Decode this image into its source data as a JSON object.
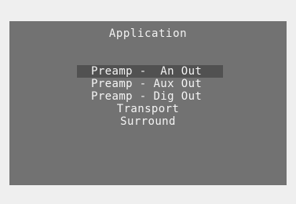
{
  "screen": {
    "title": "Application"
  },
  "menu": {
    "items": [
      {
        "label": "Preamp -  An Out",
        "selected": true
      },
      {
        "label": "Preamp - Aux Out",
        "selected": false
      },
      {
        "label": "Preamp - Dig Out",
        "selected": false
      },
      {
        "label": "Transport",
        "selected": false
      },
      {
        "label": "Surround",
        "selected": false
      }
    ]
  },
  "colors": {
    "background": "#efefef",
    "panel": "#727272",
    "selection_bar": "#515151",
    "text": "#f4f4f4"
  }
}
